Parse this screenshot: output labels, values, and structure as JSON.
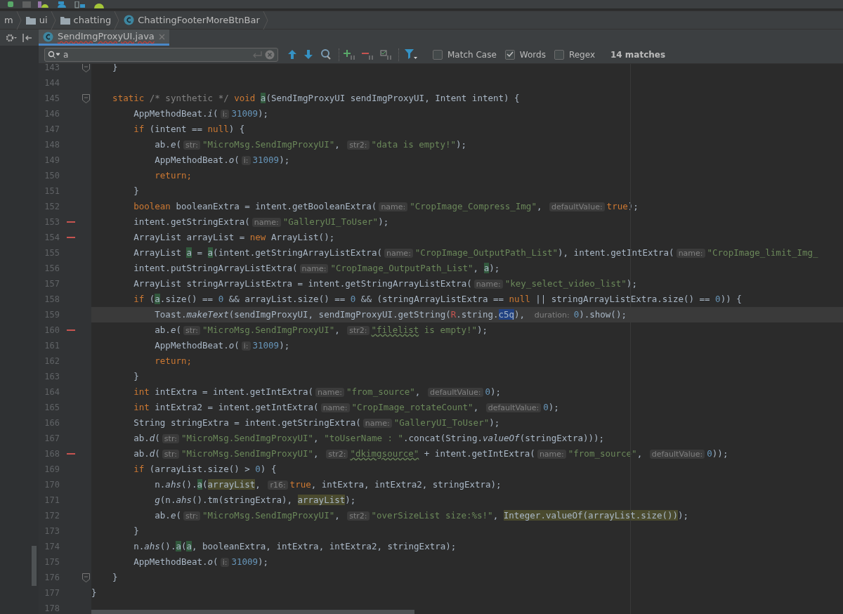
{
  "breadcrumb": [
    {
      "label": "m",
      "kind": "plain"
    },
    {
      "label": "ui",
      "kind": "folder"
    },
    {
      "label": "chatting",
      "kind": "folder"
    },
    {
      "label": "ChattingFooterMoreBtnBar",
      "kind": "class"
    }
  ],
  "tabs": [
    {
      "label": "SendImgProxyUI.java",
      "selected": true
    }
  ],
  "search": {
    "value": "a",
    "options": [
      {
        "label": "Match Case",
        "checked": false
      },
      {
        "label": "Words",
        "checked": true
      },
      {
        "label": "Regex",
        "checked": false
      }
    ],
    "match_count": "14 matches"
  },
  "editor": {
    "lines": [
      {
        "number": "143",
        "fold": true,
        "error_mark": false,
        "current": false,
        "tokens": [
          {
            "kind": "p",
            "text": "    }"
          }
        ]
      },
      {
        "number": "144",
        "fold": false,
        "error_mark": false,
        "current": false
      },
      {
        "number": "145",
        "fold": true,
        "error_mark": false,
        "current": false,
        "tokens": [
          {
            "kind": "kw",
            "text": "    static "
          },
          {
            "kind": "c",
            "text": "/* synthetic */"
          },
          {
            "kind": "kw",
            "text": " void "
          },
          {
            "kind": "m",
            "text": "a"
          },
          {
            "kind": "p",
            "text": "(SendImgProxyUI sendImgProxyUI, Intent intent) {"
          }
        ]
      },
      {
        "number": "146",
        "fold": false,
        "error_mark": false,
        "current": false,
        "tokens": [
          {
            "kind": "p",
            "text": "        AppMethodBeat."
          },
          {
            "kind": "i",
            "text": "i"
          },
          {
            "kind": "p",
            "text": "("
          },
          {
            "kind": "h",
            "text": "i:"
          },
          {
            "kind": "n",
            "text": "31009"
          },
          {
            "kind": "p",
            "text": ");"
          }
        ]
      },
      {
        "number": "147",
        "fold": false,
        "error_mark": false,
        "current": false,
        "tokens": [
          {
            "kind": "kw",
            "text": "        if"
          },
          {
            "kind": "p",
            "text": " (intent == "
          },
          {
            "kind": "kw",
            "text": "null"
          },
          {
            "kind": "p",
            "text": ") {"
          }
        ]
      },
      {
        "number": "148",
        "fold": false,
        "error_mark": false,
        "current": false,
        "tokens": [
          {
            "kind": "p",
            "text": "            ab."
          },
          {
            "kind": "i",
            "text": "e"
          },
          {
            "kind": "p",
            "text": "("
          },
          {
            "kind": "h",
            "text": "str:"
          },
          {
            "kind": "s",
            "text": "\"MicroMsg.SendImgProxyUI\""
          },
          {
            "kind": "p",
            "text": ", "
          },
          {
            "kind": "h",
            "text": "str2:"
          },
          {
            "kind": "s",
            "text": "\"data is empty!\""
          },
          {
            "kind": "p",
            "text": ");"
          }
        ]
      },
      {
        "number": "149",
        "fold": false,
        "error_mark": false,
        "current": false,
        "tokens": [
          {
            "kind": "p",
            "text": "            AppMethodBeat."
          },
          {
            "kind": "i",
            "text": "o"
          },
          {
            "kind": "p",
            "text": "("
          },
          {
            "kind": "h",
            "text": "i:"
          },
          {
            "kind": "n",
            "text": "31009"
          },
          {
            "kind": "p",
            "text": ");"
          }
        ]
      },
      {
        "number": "150",
        "fold": false,
        "error_mark": false,
        "current": false,
        "tokens": [
          {
            "kind": "kw",
            "text": "            return;"
          }
        ]
      },
      {
        "number": "151",
        "fold": false,
        "error_mark": false,
        "current": false,
        "tokens": [
          {
            "kind": "p",
            "text": "        }"
          }
        ]
      },
      {
        "number": "152",
        "fold": false,
        "error_mark": false,
        "current": false,
        "tokens": [
          {
            "kind": "kw",
            "text": "        boolean"
          },
          {
            "kind": "p",
            "text": " booleanExtra = intent.getBooleanExtra("
          },
          {
            "kind": "h",
            "text": "name:"
          },
          {
            "kind": "s",
            "text": "\"CropImage_Compress_Img\""
          },
          {
            "kind": "p",
            "text": ", "
          },
          {
            "kind": "h",
            "text": "defaultValue:"
          },
          {
            "kind": "kw",
            "text": "true"
          },
          {
            "kind": "p",
            "text": ");"
          }
        ]
      },
      {
        "number": "153",
        "fold": false,
        "error_mark": true,
        "current": false,
        "tokens": [
          {
            "kind": "p",
            "text": "        intent.getStringExtra("
          },
          {
            "kind": "h",
            "text": "name:"
          },
          {
            "kind": "s",
            "text": "\"GalleryUI_ToUser\""
          },
          {
            "kind": "p",
            "text": ");"
          }
        ]
      },
      {
        "number": "154",
        "fold": false,
        "error_mark": true,
        "current": false,
        "tokens": [
          {
            "kind": "p",
            "text": "        ArrayList arrayList = "
          },
          {
            "kind": "kw",
            "text": "new"
          },
          {
            "kind": "p",
            "text": " ArrayList();"
          }
        ]
      },
      {
        "number": "155",
        "fold": false,
        "error_mark": false,
        "current": false,
        "tokens": [
          {
            "kind": "p",
            "text": "        ArrayList "
          },
          {
            "kind": "m",
            "text": "a"
          },
          {
            "kind": "p",
            "text": " = "
          },
          {
            "kind": "m",
            "text": "a"
          },
          {
            "kind": "p",
            "text": "(intent.getStringArrayListExtra("
          },
          {
            "kind": "h",
            "text": "name:"
          },
          {
            "kind": "s",
            "text": "\"CropImage_OutputPath_List\""
          },
          {
            "kind": "p",
            "text": "), intent.getIntExtra("
          },
          {
            "kind": "h",
            "text": "name:"
          },
          {
            "kind": "s",
            "text": "\"CropImage_limit_Img_"
          }
        ]
      },
      {
        "number": "156",
        "fold": false,
        "error_mark": false,
        "current": false,
        "tokens": [
          {
            "kind": "p",
            "text": "        intent.putStringArrayListExtra("
          },
          {
            "kind": "h",
            "text": "name:"
          },
          {
            "kind": "s",
            "text": "\"CropImage_OutputPath_List\""
          },
          {
            "kind": "p",
            "text": ", "
          },
          {
            "kind": "m",
            "text": "a"
          },
          {
            "kind": "p",
            "text": ");"
          }
        ]
      },
      {
        "number": "157",
        "fold": false,
        "error_mark": false,
        "current": false,
        "tokens": [
          {
            "kind": "p",
            "text": "        ArrayList stringArrayListExtra = intent.getStringArrayListExtra("
          },
          {
            "kind": "h",
            "text": "name:"
          },
          {
            "kind": "s",
            "text": "\"key_select_video_list\""
          },
          {
            "kind": "p",
            "text": ");"
          }
        ]
      },
      {
        "number": "158",
        "fold": false,
        "error_mark": false,
        "current": false,
        "tokens": [
          {
            "kind": "kw",
            "text": "        if"
          },
          {
            "kind": "p",
            "text": " ("
          },
          {
            "kind": "m",
            "text": "a"
          },
          {
            "kind": "p",
            "text": ".size() == "
          },
          {
            "kind": "n",
            "text": "0"
          },
          {
            "kind": "p",
            "text": " && arrayList.size() == "
          },
          {
            "kind": "n",
            "text": "0"
          },
          {
            "kind": "p",
            "text": " && (stringArrayListExtra == "
          },
          {
            "kind": "kw",
            "text": "null"
          },
          {
            "kind": "p",
            "text": " || stringArrayListExtra.size() == "
          },
          {
            "kind": "n",
            "text": "0"
          },
          {
            "kind": "p",
            "text": ")) {"
          }
        ]
      },
      {
        "number": "159",
        "fold": false,
        "error_mark": false,
        "current": true,
        "tokens": [
          {
            "kind": "p",
            "text": "            Toast."
          },
          {
            "kind": "i",
            "text": "makeText"
          },
          {
            "kind": "p",
            "text": "(sendImgProxyUI, sendImgProxyUI.getString("
          },
          {
            "kind": "r",
            "text": "R"
          },
          {
            "kind": "p",
            "text": ".string."
          },
          {
            "kind": "sel",
            "text": "c5q"
          },
          {
            "kind": "p",
            "text": "), "
          },
          {
            "kind": "h",
            "text": "duration:"
          },
          {
            "kind": "n",
            "text": "0"
          },
          {
            "kind": "p",
            "text": ").show();"
          }
        ]
      },
      {
        "number": "160",
        "fold": false,
        "error_mark": true,
        "current": false,
        "tokens": [
          {
            "kind": "p",
            "text": "            ab."
          },
          {
            "kind": "i",
            "text": "e"
          },
          {
            "kind": "p",
            "text": "("
          },
          {
            "kind": "h",
            "text": "str:"
          },
          {
            "kind": "s",
            "text": "\"MicroMsg.SendImgProxyUI\""
          },
          {
            "kind": "p",
            "text": ", "
          },
          {
            "kind": "h",
            "text": "str2:"
          },
          {
            "kind": "typo",
            "text": "\"filelist"
          },
          {
            "kind": "s",
            "text": " is empty!\""
          },
          {
            "kind": "p",
            "text": ");"
          }
        ]
      },
      {
        "number": "161",
        "fold": false,
        "error_mark": false,
        "current": false,
        "tokens": [
          {
            "kind": "p",
            "text": "            AppMethodBeat."
          },
          {
            "kind": "i",
            "text": "o"
          },
          {
            "kind": "p",
            "text": "("
          },
          {
            "kind": "h",
            "text": "i:"
          },
          {
            "kind": "n",
            "text": "31009"
          },
          {
            "kind": "p",
            "text": ");"
          }
        ]
      },
      {
        "number": "162",
        "fold": false,
        "error_mark": false,
        "current": false,
        "tokens": [
          {
            "kind": "kw",
            "text": "            return;"
          }
        ]
      },
      {
        "number": "163",
        "fold": false,
        "error_mark": false,
        "current": false,
        "tokens": [
          {
            "kind": "p",
            "text": "        }"
          }
        ]
      },
      {
        "number": "164",
        "fold": false,
        "error_mark": false,
        "current": false,
        "tokens": [
          {
            "kind": "kw",
            "text": "        int"
          },
          {
            "kind": "p",
            "text": " intExtra = intent.getIntExtra("
          },
          {
            "kind": "h",
            "text": "name:"
          },
          {
            "kind": "s",
            "text": "\"from_source\""
          },
          {
            "kind": "p",
            "text": ", "
          },
          {
            "kind": "h",
            "text": "defaultValue:"
          },
          {
            "kind": "n",
            "text": "0"
          },
          {
            "kind": "p",
            "text": ");"
          }
        ]
      },
      {
        "number": "165",
        "fold": false,
        "error_mark": false,
        "current": false,
        "tokens": [
          {
            "kind": "kw",
            "text": "        int"
          },
          {
            "kind": "p",
            "text": " intExtra2 = intent.getIntExtra("
          },
          {
            "kind": "h",
            "text": "name:"
          },
          {
            "kind": "s",
            "text": "\"CropImage_rotateCount\""
          },
          {
            "kind": "p",
            "text": ", "
          },
          {
            "kind": "h",
            "text": "defaultValue:"
          },
          {
            "kind": "n",
            "text": "0"
          },
          {
            "kind": "p",
            "text": ");"
          }
        ]
      },
      {
        "number": "166",
        "fold": false,
        "error_mark": false,
        "current": false,
        "tokens": [
          {
            "kind": "p",
            "text": "        String stringExtra = intent.getStringExtra("
          },
          {
            "kind": "h",
            "text": "name:"
          },
          {
            "kind": "s",
            "text": "\"GalleryUI_ToUser\""
          },
          {
            "kind": "p",
            "text": ");"
          }
        ]
      },
      {
        "number": "167",
        "fold": false,
        "error_mark": false,
        "current": false,
        "tokens": [
          {
            "kind": "p",
            "text": "        ab."
          },
          {
            "kind": "i",
            "text": "d"
          },
          {
            "kind": "p",
            "text": "("
          },
          {
            "kind": "h",
            "text": "str:"
          },
          {
            "kind": "s",
            "text": "\"MicroMsg.SendImgProxyUI\""
          },
          {
            "kind": "p",
            "text": ", "
          },
          {
            "kind": "s",
            "text": "\"toUserName : \""
          },
          {
            "kind": "p",
            "text": ".concat(String."
          },
          {
            "kind": "i",
            "text": "valueOf"
          },
          {
            "kind": "p",
            "text": "(stringExtra)));"
          }
        ]
      },
      {
        "number": "168",
        "fold": false,
        "error_mark": true,
        "current": false,
        "tokens": [
          {
            "kind": "p",
            "text": "        ab."
          },
          {
            "kind": "i",
            "text": "d"
          },
          {
            "kind": "p",
            "text": "("
          },
          {
            "kind": "h",
            "text": "str:"
          },
          {
            "kind": "s",
            "text": "\"MicroMsg.SendImgProxyUI\""
          },
          {
            "kind": "p",
            "text": ", "
          },
          {
            "kind": "h",
            "text": "str2:"
          },
          {
            "kind": "typo",
            "text": "\"dkimgsource\""
          },
          {
            "kind": "p",
            "text": " + intent.getIntExtra("
          },
          {
            "kind": "h",
            "text": "name:"
          },
          {
            "kind": "s",
            "text": "\"from_source\""
          },
          {
            "kind": "p",
            "text": ", "
          },
          {
            "kind": "h",
            "text": "defaultValue:"
          },
          {
            "kind": "n",
            "text": "0"
          },
          {
            "kind": "p",
            "text": "));"
          }
        ]
      },
      {
        "number": "169",
        "fold": false,
        "error_mark": false,
        "current": false,
        "tokens": [
          {
            "kind": "kw",
            "text": "        if"
          },
          {
            "kind": "p",
            "text": " (arrayList.size() > "
          },
          {
            "kind": "n",
            "text": "0"
          },
          {
            "kind": "p",
            "text": ") {"
          }
        ]
      },
      {
        "number": "170",
        "fold": false,
        "error_mark": false,
        "current": false,
        "tokens": [
          {
            "kind": "p",
            "text": "            n."
          },
          {
            "kind": "i",
            "text": "ahs"
          },
          {
            "kind": "p",
            "text": "()."
          },
          {
            "kind": "m",
            "text": "a"
          },
          {
            "kind": "p",
            "text": "("
          },
          {
            "kind": "u",
            "text": "arrayList"
          },
          {
            "kind": "p",
            "text": ", "
          },
          {
            "kind": "h",
            "text": "r16:"
          },
          {
            "kind": "kw",
            "text": "true"
          },
          {
            "kind": "p",
            "text": ", intExtra, intExtra2, stringExtra);"
          }
        ]
      },
      {
        "number": "171",
        "fold": false,
        "error_mark": false,
        "current": false,
        "tokens": [
          {
            "kind": "i",
            "text": "            g"
          },
          {
            "kind": "p",
            "text": "(n."
          },
          {
            "kind": "i",
            "text": "ahs"
          },
          {
            "kind": "p",
            "text": "().tm(stringExtra), "
          },
          {
            "kind": "u",
            "text": "arrayList"
          },
          {
            "kind": "p",
            "text": ");"
          }
        ]
      },
      {
        "number": "172",
        "fold": false,
        "error_mark": false,
        "current": false,
        "tokens": [
          {
            "kind": "p",
            "text": "            ab."
          },
          {
            "kind": "i",
            "text": "e"
          },
          {
            "kind": "p",
            "text": "("
          },
          {
            "kind": "h",
            "text": "str:"
          },
          {
            "kind": "s",
            "text": "\"MicroMsg.SendImgProxyUI\""
          },
          {
            "kind": "p",
            "text": ", "
          },
          {
            "kind": "h",
            "text": "str2:"
          },
          {
            "kind": "s",
            "text": "\"overSizeList size:%s!\""
          },
          {
            "kind": "p",
            "text": ", "
          },
          {
            "kind": "u",
            "text": "Integer.valueOf(arrayList.size())"
          },
          {
            "kind": "p",
            "text": ");"
          }
        ]
      },
      {
        "number": "173",
        "fold": false,
        "error_mark": false,
        "current": false,
        "tokens": [
          {
            "kind": "p",
            "text": "        }"
          }
        ]
      },
      {
        "number": "174",
        "fold": false,
        "error_mark": false,
        "current": false,
        "tokens": [
          {
            "kind": "p",
            "text": "        n."
          },
          {
            "kind": "i",
            "text": "ahs"
          },
          {
            "kind": "p",
            "text": "()."
          },
          {
            "kind": "m",
            "text": "a"
          },
          {
            "kind": "p",
            "text": "("
          },
          {
            "kind": "m",
            "text": "a"
          },
          {
            "kind": "p",
            "text": ", booleanExtra, intExtra, intExtra2, stringExtra);"
          }
        ]
      },
      {
        "number": "175",
        "fold": false,
        "error_mark": false,
        "current": false,
        "tokens": [
          {
            "kind": "p",
            "text": "        AppMethodBeat."
          },
          {
            "kind": "i",
            "text": "o"
          },
          {
            "kind": "p",
            "text": "("
          },
          {
            "kind": "h",
            "text": "i:"
          },
          {
            "kind": "n",
            "text": "31009"
          },
          {
            "kind": "p",
            "text": ");"
          }
        ]
      },
      {
        "number": "176",
        "fold": true,
        "error_mark": false,
        "current": false,
        "tokens": [
          {
            "kind": "p",
            "text": "    }"
          }
        ]
      },
      {
        "number": "177",
        "fold": false,
        "error_mark": false,
        "current": false,
        "tokens": [
          {
            "kind": "p",
            "text": "}"
          }
        ]
      },
      {
        "number": "178",
        "fold": false,
        "error_mark": false,
        "current": false
      }
    ]
  }
}
